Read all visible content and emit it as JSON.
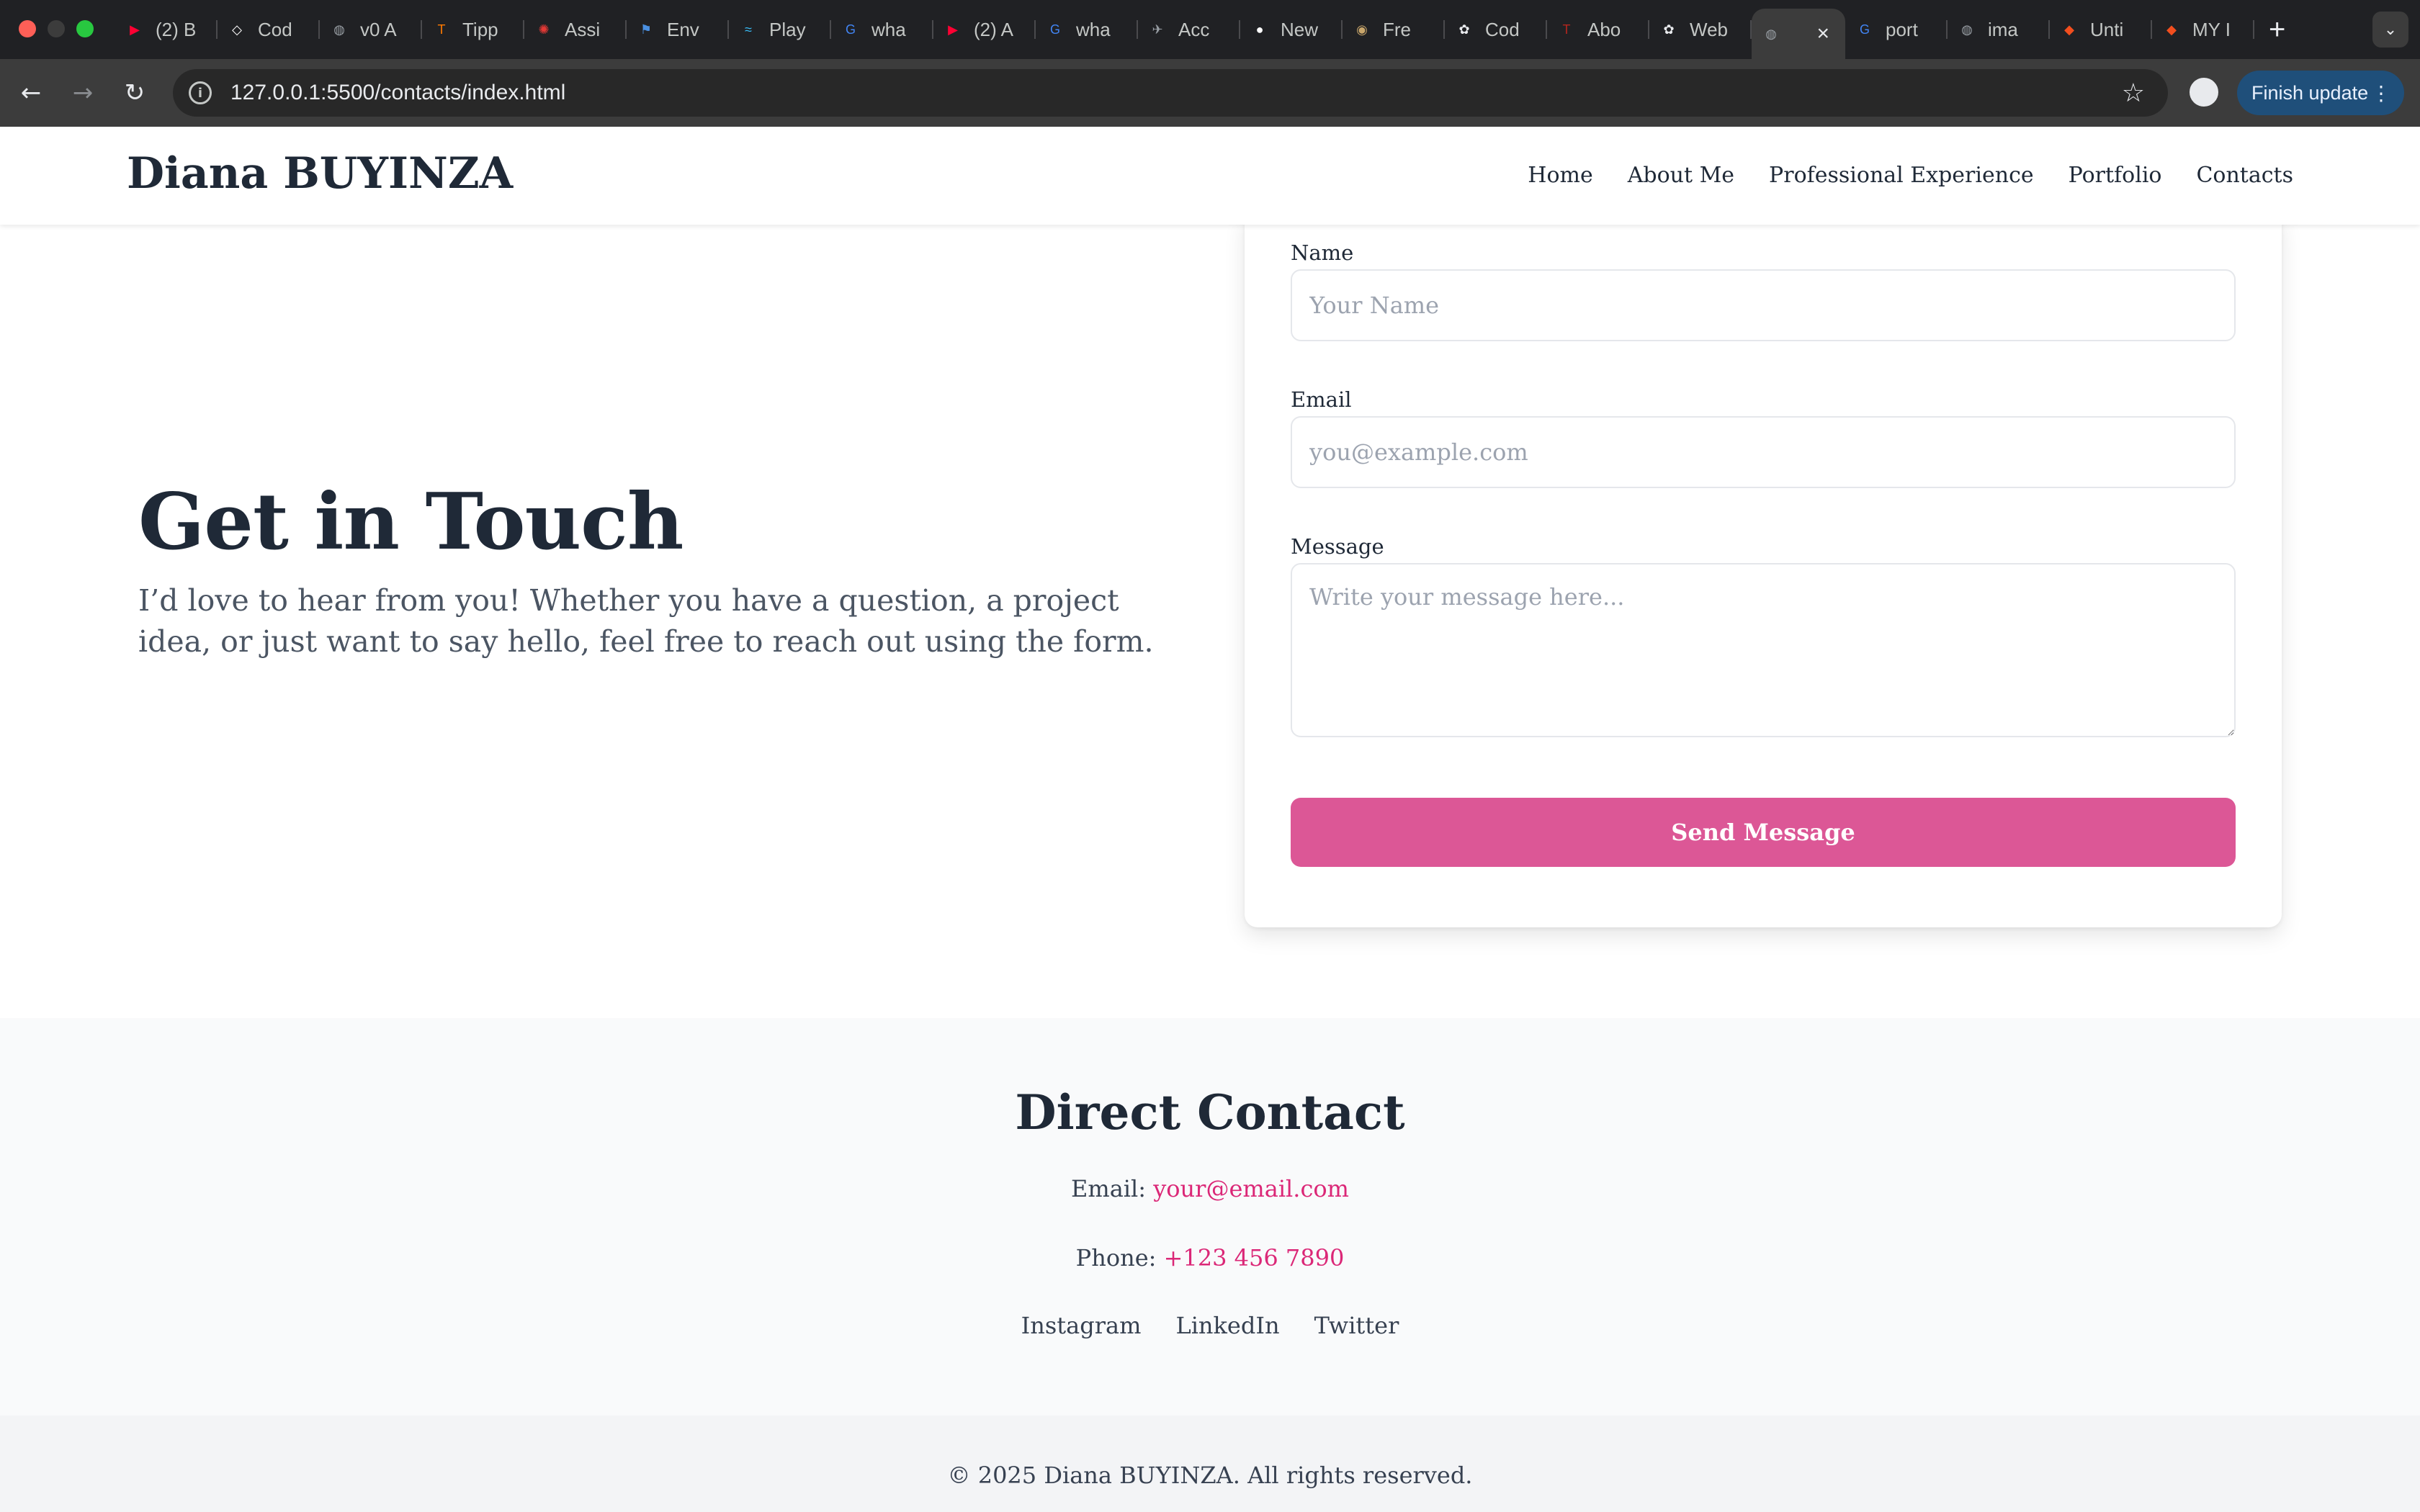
{
  "browser": {
    "tabs": [
      {
        "label": "(2) B",
        "icon": "youtube-icon",
        "color": "#ff0033"
      },
      {
        "label": "Cod",
        "icon": "codepen-icon",
        "color": "#ffffff"
      },
      {
        "label": "v0 A",
        "icon": "globe-icon",
        "color": "#9aa0a6"
      },
      {
        "label": "Tipp",
        "icon": "tippy-icon",
        "color": "#ff7a00"
      },
      {
        "label": "Assi",
        "icon": "assistant-icon",
        "color": "#e53935"
      },
      {
        "label": "Env",
        "icon": "flag-icon",
        "color": "#4a90e2"
      },
      {
        "label": "Play",
        "icon": "tailwind-icon",
        "color": "#38bdf8"
      },
      {
        "label": "wha",
        "icon": "google-icon",
        "color": "#4285f4"
      },
      {
        "label": "(2) A",
        "icon": "youtube-icon",
        "color": "#ff0033"
      },
      {
        "label": "wha",
        "icon": "google-icon",
        "color": "#4285f4"
      },
      {
        "label": "Acc",
        "icon": "plane-icon",
        "color": "#9aa0a6"
      },
      {
        "label": "New",
        "icon": "github-icon",
        "color": "#ffffff"
      },
      {
        "label": "Fre",
        "icon": "freecodecamp-icon",
        "color": "#c9a66b"
      },
      {
        "label": "Cod",
        "icon": "openai-icon",
        "color": "#e8eaed"
      },
      {
        "label": "Abo",
        "icon": "t-icon",
        "color": "#b3261e"
      },
      {
        "label": "Web",
        "icon": "openai-icon",
        "color": "#e8eaed"
      },
      {
        "label": "",
        "icon": "globe-icon",
        "color": "#9aa0a6",
        "active": true
      },
      {
        "label": "port",
        "icon": "google-icon",
        "color": "#4285f4"
      },
      {
        "label": "ima",
        "icon": "globe-icon",
        "color": "#9aa0a6"
      },
      {
        "label": "Unti",
        "icon": "figma-icon",
        "color": "#f24e1e"
      },
      {
        "label": "MY I",
        "icon": "figma-icon",
        "color": "#f24e1e"
      }
    ],
    "new_tab": "+",
    "url": "127.0.0.1:5500/contacts/index.html",
    "finish_update_label": "Finish update"
  },
  "header": {
    "brand": "Diana BUYINZA",
    "nav": [
      "Home",
      "About Me",
      "Professional Experience",
      "Portfolio",
      "Contacts"
    ]
  },
  "intro": {
    "title": "Get in Touch",
    "text": "I’d love to hear from you! Whether you have a question, a project idea, or just want to say hello, feel free to reach out using the form."
  },
  "form": {
    "name_label": "Name",
    "name_placeholder": "Your Name",
    "email_label": "Email",
    "email_placeholder": "you@example.com",
    "message_label": "Message",
    "message_placeholder": "Write your message here...",
    "submit_label": "Send Message",
    "accent_color": "#dc5796"
  },
  "direct_contact": {
    "title": "Direct Contact",
    "email_label": "Email:",
    "email_value": "your@email.com",
    "phone_label": "Phone:",
    "phone_value": "+123 456 7890",
    "socials": [
      "Instagram",
      "LinkedIn",
      "Twitter"
    ]
  },
  "footer": {
    "copyright": "© 2025 Diana BUYINZA. All rights reserved."
  }
}
